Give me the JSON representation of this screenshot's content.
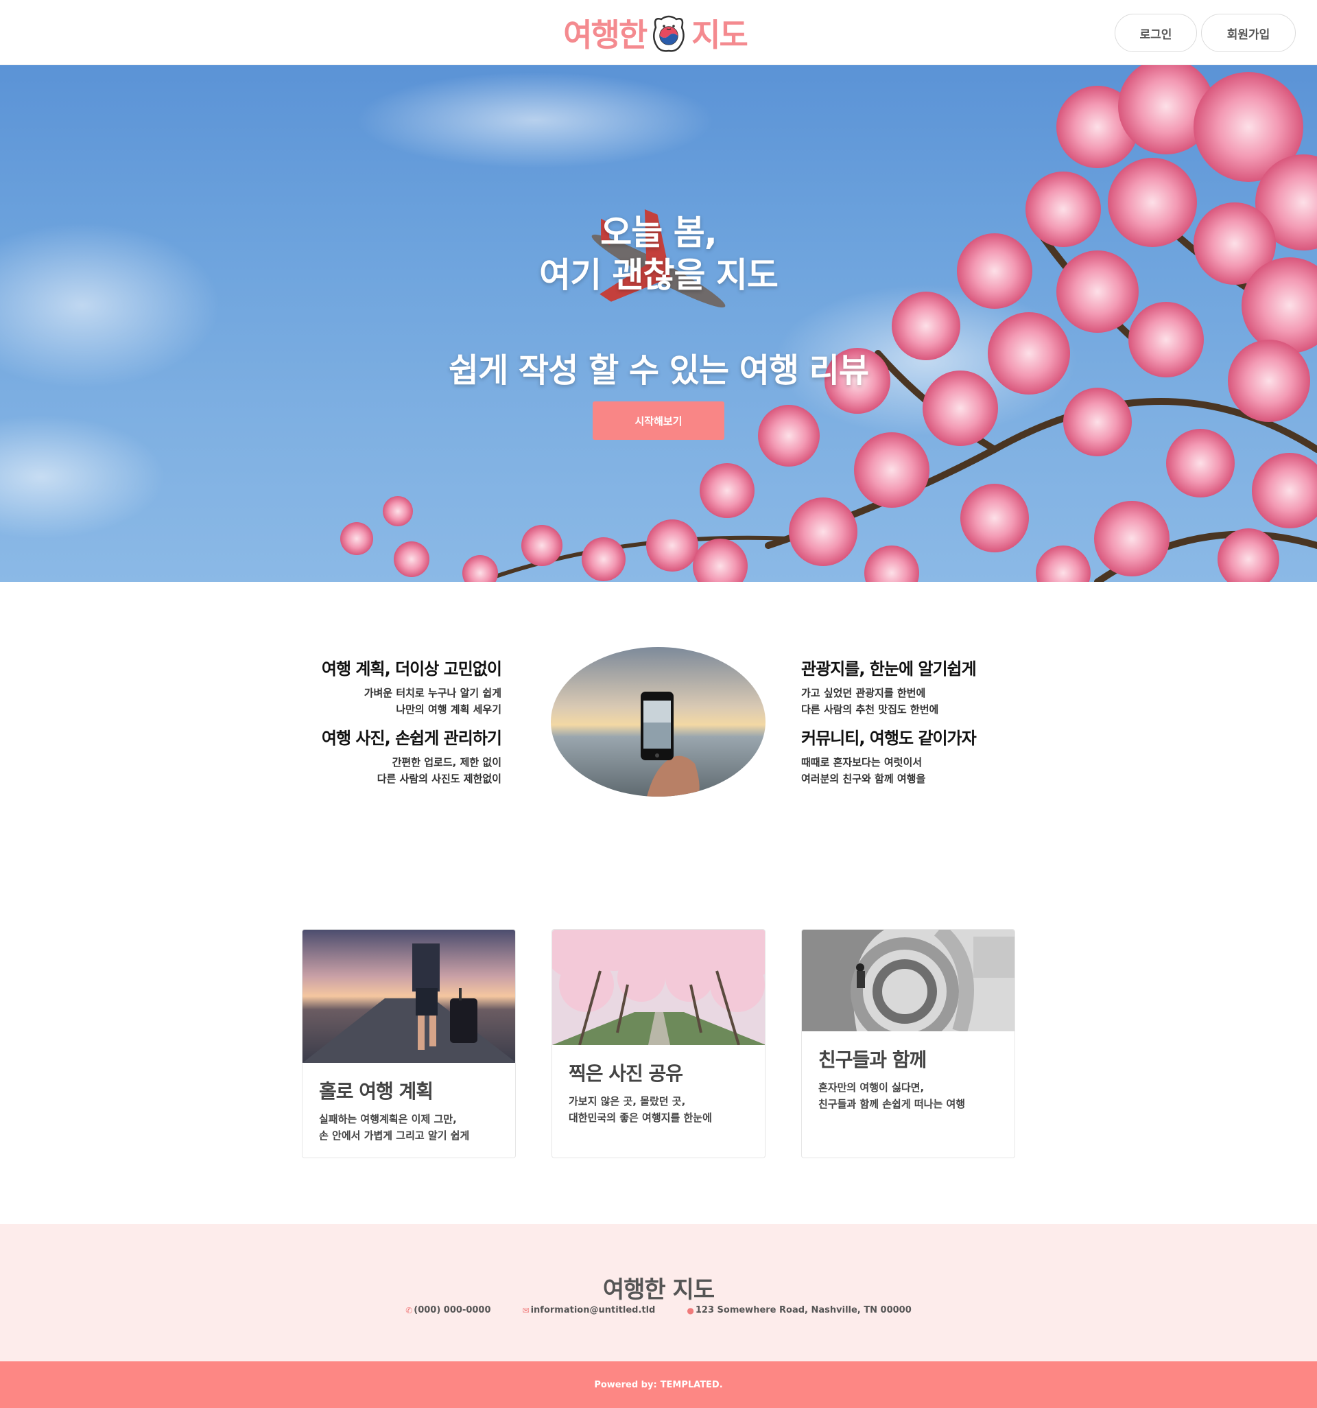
{
  "header": {
    "logo_left": "여행한",
    "logo_right": "지도",
    "login_label": "로그인",
    "signup_label": "회원가입"
  },
  "hero": {
    "title_line1": "오늘 봄,",
    "title_line2": "여기 괜찮을 지도",
    "subtitle": "쉽게 작성 할 수 있는 여행 리뷰",
    "cta_label": "시작해보기"
  },
  "features": [
    {
      "title": "여행 계획, 더이상 고민없이",
      "line1": "가벼운 터치로 누구나 알기 쉽게",
      "line2": "나만의 여행 계획 세우기"
    },
    {
      "title": "여행 사진, 손쉽게 관리하기",
      "line1": "간편한 업로드, 제한 없이",
      "line2": "다른 사람의 사진도 제한없이"
    },
    {
      "title": "관광지를, 한눈에 알기쉽게",
      "line1": "가고 싶었던 관광지를 한번에",
      "line2": "다른 사람의 추천 맛집도 한번에"
    },
    {
      "title": "커뮤니티, 여행도 같이가자",
      "line1": "때때로 혼자보다는 여럿이서",
      "line2": "여러분의 친구와 함께 여행을"
    }
  ],
  "cards": [
    {
      "title": "홀로 여행 계획",
      "line1": "실패하는 여행계획은 이제 그만,",
      "line2": "손 안에서 가볍게 그리고 알기 쉽게"
    },
    {
      "title": "찍은 사진 공유",
      "line1": "가보지 않은 곳, 몰랐던 곳,",
      "line2": "대한민국의 좋은 여행지를 한눈에"
    },
    {
      "title": "친구들과 함께",
      "line1": "혼자만의 여행이 싫다면,",
      "line2": "친구들과 함께 손쉽게 떠나는 여행"
    }
  ],
  "footer": {
    "title": "여행한 지도",
    "phone": "(000) 000-0000",
    "email": "information@untitled.tld",
    "address": "123 Somewhere Road, Nashville, TN 00000",
    "powered_prefix": "Powered by:",
    "powered_brand": "TEMPLATED."
  },
  "colors": {
    "accent": "#fd8784",
    "logo_pink": "#f48a8f",
    "footer_bg": "#fdeceb",
    "sky_blue": "#6da3dd"
  },
  "icons": [
    "mascot-logo-icon",
    "phone-icon",
    "mail-icon",
    "map-pin-icon"
  ]
}
